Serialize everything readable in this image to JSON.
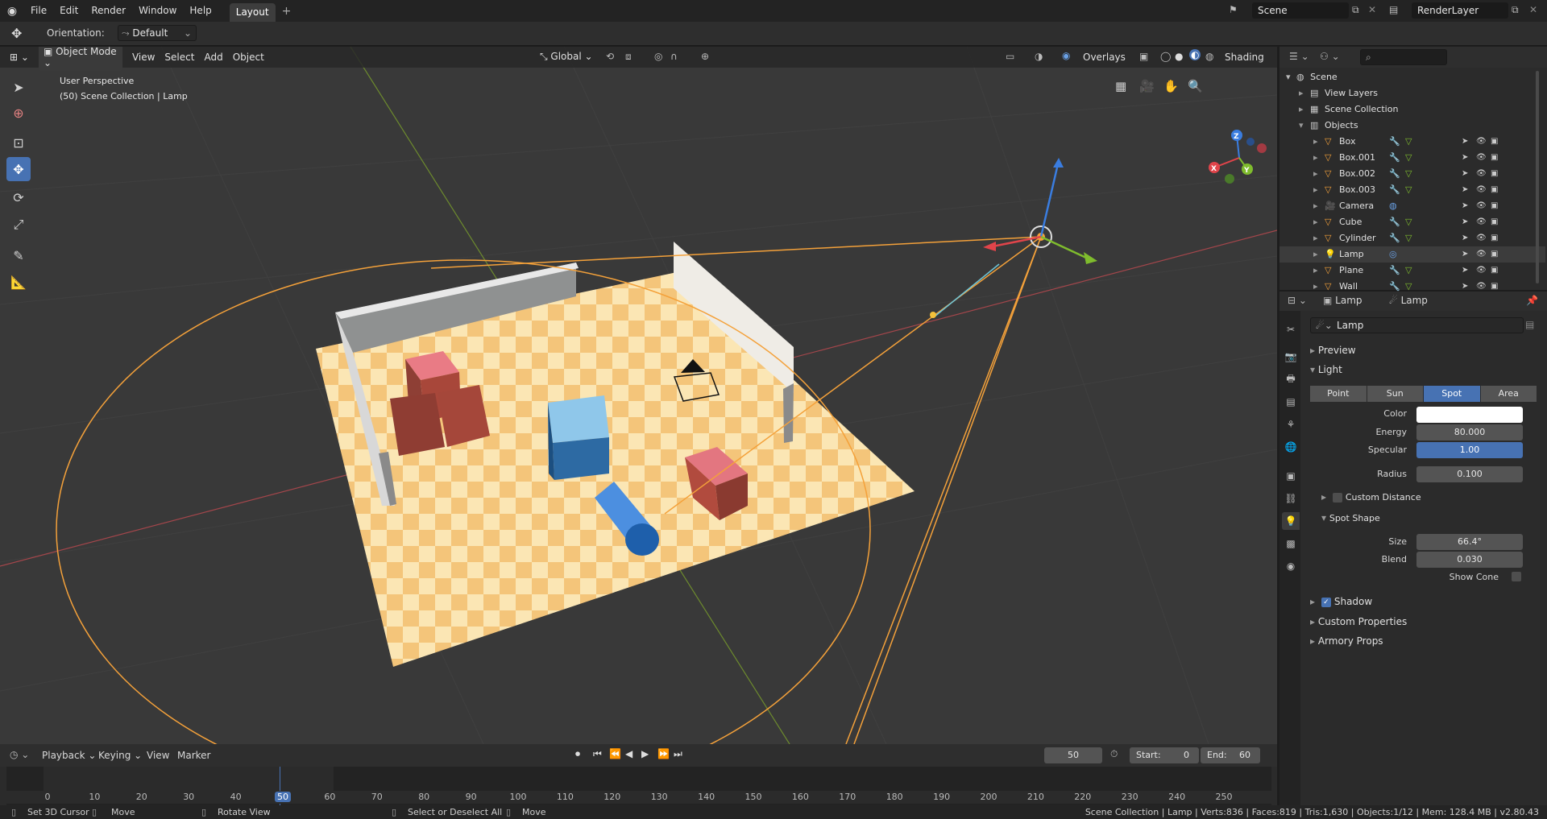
{
  "topbar": {
    "menus": [
      "File",
      "Edit",
      "Render",
      "Window",
      "Help"
    ],
    "workspace_tab": "Layout",
    "add_tab": "+",
    "scene_name": "Scene",
    "render_layer": "RenderLayer"
  },
  "tool_header": {
    "orientation_label": "Orientation:",
    "orientation_value": "Default"
  },
  "viewport": {
    "mode": "Object Mode",
    "menus": [
      "View",
      "Select",
      "Add",
      "Object"
    ],
    "transform_orientation": "Global",
    "overlays": "Overlays",
    "shading": "Shading",
    "info_line1": "User Perspective",
    "info_line2": "(50) Scene Collection | Lamp",
    "gizmo_axes": {
      "x": "X",
      "y": "Y",
      "z": "Z"
    }
  },
  "outliner": {
    "root": "Scene",
    "rows": [
      {
        "name": "View Layers",
        "indent": 1
      },
      {
        "name": "Scene Collection",
        "indent": 1
      },
      {
        "name": "Objects",
        "indent": 1
      },
      {
        "name": "Box",
        "indent": 2
      },
      {
        "name": "Box.001",
        "indent": 2
      },
      {
        "name": "Box.002",
        "indent": 2
      },
      {
        "name": "Box.003",
        "indent": 2
      },
      {
        "name": "Camera",
        "indent": 2
      },
      {
        "name": "Cube",
        "indent": 2
      },
      {
        "name": "Cylinder",
        "indent": 2
      },
      {
        "name": "Lamp",
        "indent": 2,
        "selected": true
      },
      {
        "name": "Plane",
        "indent": 2
      },
      {
        "name": "Wall",
        "indent": 2
      }
    ]
  },
  "properties": {
    "breadcrumb_object": "Lamp",
    "breadcrumb_data": "Lamp",
    "datablock": "Lamp",
    "sections": {
      "preview": "Preview",
      "light": "Light",
      "shadow": "Shadow",
      "custom_properties": "Custom Properties",
      "armory_props": "Armory Props",
      "custom_distance": "Custom Distance",
      "spot_shape": "Spot Shape"
    },
    "light_types": [
      "Point",
      "Sun",
      "Spot",
      "Area"
    ],
    "active_light_type": "Spot",
    "fields": {
      "color_label": "Color",
      "energy_label": "Energy",
      "energy": "80.000",
      "specular_label": "Specular",
      "specular": "1.00",
      "radius_label": "Radius",
      "radius": "0.100",
      "size_label": "Size",
      "size": "66.4°",
      "blend_label": "Blend",
      "blend": "0.030",
      "show_cone_label": "Show Cone"
    },
    "shadow_enabled": true,
    "custom_distance_enabled": false
  },
  "timeline": {
    "menus": [
      "Playback",
      "Keying",
      "View",
      "Marker"
    ],
    "current_frame": "50",
    "start_label": "Start:",
    "start": "0",
    "end_label": "End:",
    "end": "60",
    "ticks": [
      "0",
      "10",
      "20",
      "30",
      "40",
      "50",
      "60",
      "70",
      "80",
      "90",
      "100",
      "110",
      "120",
      "130",
      "140",
      "150",
      "160",
      "170",
      "180",
      "190",
      "200",
      "210",
      "220",
      "230",
      "240",
      "250"
    ]
  },
  "statusbar": {
    "hint1": "Set 3D Cursor",
    "hint2": "Move",
    "hint3": "Rotate View",
    "hint4": "Select or Deselect All",
    "hint5": "Move",
    "stats": "Scene Collection | Lamp | Verts:836 | Faces:819 | Tris:1,630 | Objects:1/12 | Mem: 128.4 MB | v2.80.43"
  },
  "colors": {
    "accent": "#4772b3",
    "floor_light": "#fbe6b4",
    "floor_dark": "#f4c57a",
    "lamp_orange": "#f4a13a"
  }
}
